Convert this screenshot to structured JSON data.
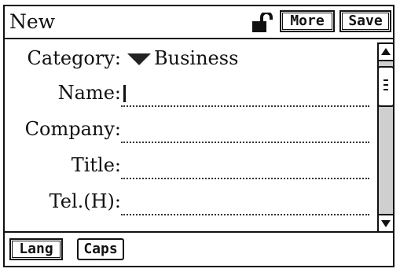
{
  "title": "New",
  "toolbar": {
    "more_label": "More",
    "save_label": "Save"
  },
  "category": {
    "label": "Category:",
    "value": "Business"
  },
  "fields": [
    {
      "label": "Name:"
    },
    {
      "label": "Company:"
    },
    {
      "label": "Title:"
    },
    {
      "label": "Tel.(H):"
    }
  ],
  "bottom": {
    "lang_label": "Lang",
    "caps_label": "Caps"
  },
  "icons": {
    "lock": "unlocked-padlock-icon",
    "category": "dropdown-triangle-icon"
  }
}
